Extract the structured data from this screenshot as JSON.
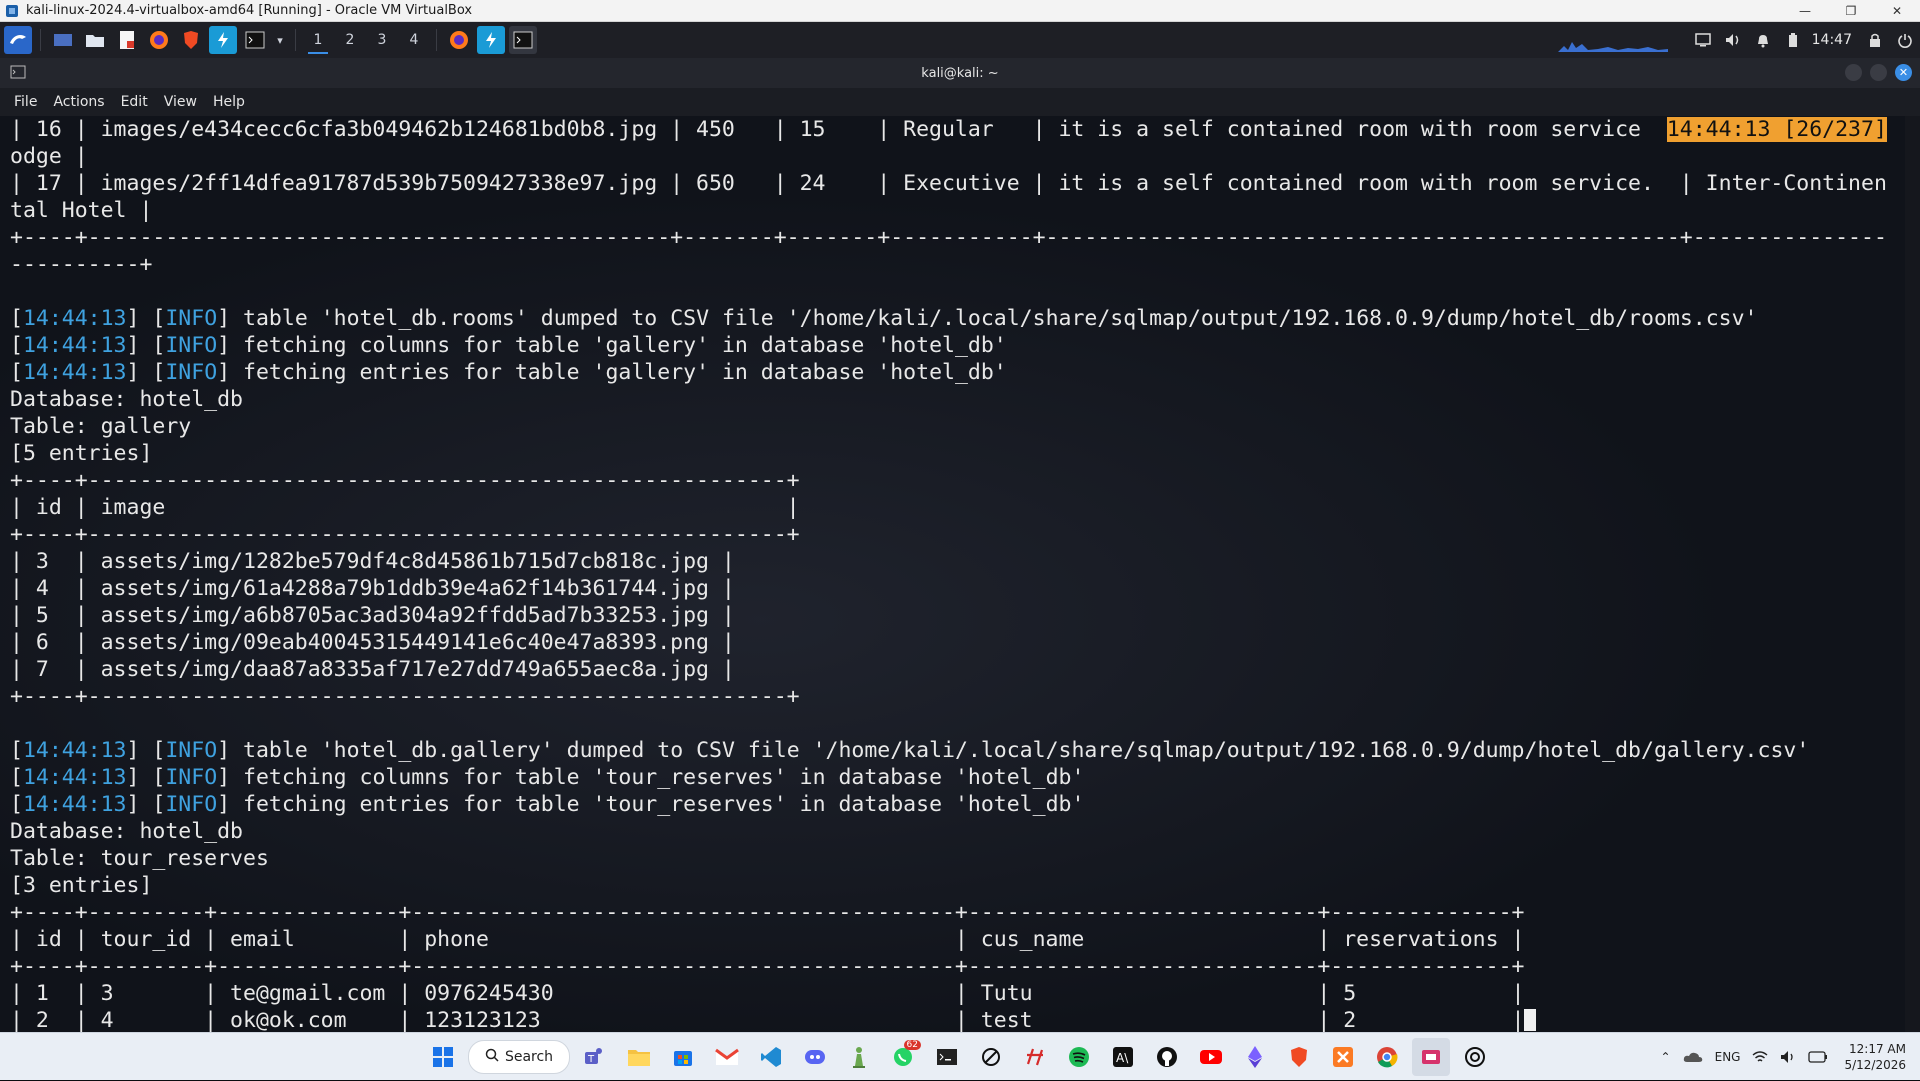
{
  "vbox": {
    "title": "kali-linux-2024.4-virtualbox-amd64 [Running] - Oracle VM VirtualBox"
  },
  "kali_panel": {
    "workspaces": [
      "1",
      "2",
      "3",
      "4"
    ],
    "clock": "14:47"
  },
  "terminal": {
    "title": "kali@kali: ~",
    "menu": [
      "File",
      "Actions",
      "Edit",
      "View",
      "Help"
    ],
    "lines": {
      "l01": "| 16 | images/e434cecc6cfa3b049462b124681bd0b8.jpg | 450   | 15    | Regular   | it is a self contained room with room service  ",
      "l01_hl": "14:44:13 [26/237]",
      "l02": "odge |",
      "l03": "| 17 | images/2ff14dfea91787d539b7509427338e97.jpg | 650   | 24    | Executive | it is a self contained room with room service.  | Inter-Continen",
      "l04": "tal Hotel |",
      "l05": "+----+---------------------------------------------+-------+-------+-----------+-------------------------------------------------+---------------",
      "l06": "----------+",
      "r1_ts": "14:44:13",
      "r1_lvl": "INFO",
      "r1_msg": " table 'hotel_db.rooms' dumped to CSV file '/home/kali/.local/share/sqlmap/output/192.168.0.9/dump/hotel_db/rooms.csv'",
      "r2_ts": "14:44:13",
      "r2_lvl": "INFO",
      "r2_msg": " fetching columns for table 'gallery' in database 'hotel_db'",
      "r3_ts": "14:44:13",
      "r3_lvl": "INFO",
      "r3_msg": " fetching entries for table 'gallery' in database 'hotel_db'",
      "g_db": "Database: hotel_db",
      "g_table": "Table: gallery",
      "g_count": "[5 entries]",
      "g_sep1": "+----+------------------------------------------------------+",
      "g_head": "| id | image                                                |",
      "g_sep2": "+----+------------------------------------------------------+",
      "g_r1": "| 3  | assets/img/1282be579df4c8d45861b715d7cb818c.jpg |",
      "g_r2": "| 4  | assets/img/61a4288a79b1ddb39e4a62f14b361744.jpg |",
      "g_r3": "| 5  | assets/img/a6b8705ac3ad304a92ffdd5ad7b33253.jpg |",
      "g_r4": "| 6  | assets/img/09eab40045315449141e6c40e47a8393.png |",
      "g_r5": "| 7  | assets/img/daa87a8335af717e27dd749a655aec8a.jpg |",
      "g_sep3": "+----+------------------------------------------------------+",
      "r4_ts": "14:44:13",
      "r4_lvl": "INFO",
      "r4_msg": " table 'hotel_db.gallery' dumped to CSV file '/home/kali/.local/share/sqlmap/output/192.168.0.9/dump/hotel_db/gallery.csv'",
      "r5_ts": "14:44:13",
      "r5_lvl": "INFO",
      "r5_msg": " fetching columns for table 'tour_reserves' in database 'hotel_db'",
      "r6_ts": "14:44:13",
      "r6_lvl": "INFO",
      "r6_msg": " fetching entries for table 'tour_reserves' in database 'hotel_db'",
      "t_db": "Database: hotel_db",
      "t_table": "Table: tour_reserves",
      "t_count": "[3 entries]",
      "t_sep1": "+----+---------+--------------+------------------------------------------+---------------------------+--------------+",
      "t_head": "| id | tour_id | email        | phone                                    | cus_name                  | reservations |",
      "t_sep2": "+----+---------+--------------+------------------------------------------+---------------------------+--------------+",
      "t_r1": "| 1  | 3       | te@gmail.com | 0976245430                               | Tutu                      | 5            |",
      "t_r2": "| 2  | 4       | ok@ok.com    | 123123123                                | test                      | 2            |"
    }
  },
  "taskbar": {
    "search_label": "Search",
    "whatsapp_badge": "62",
    "lang": "ENG",
    "time": "12:17 AM",
    "date": "5/12/2026"
  }
}
